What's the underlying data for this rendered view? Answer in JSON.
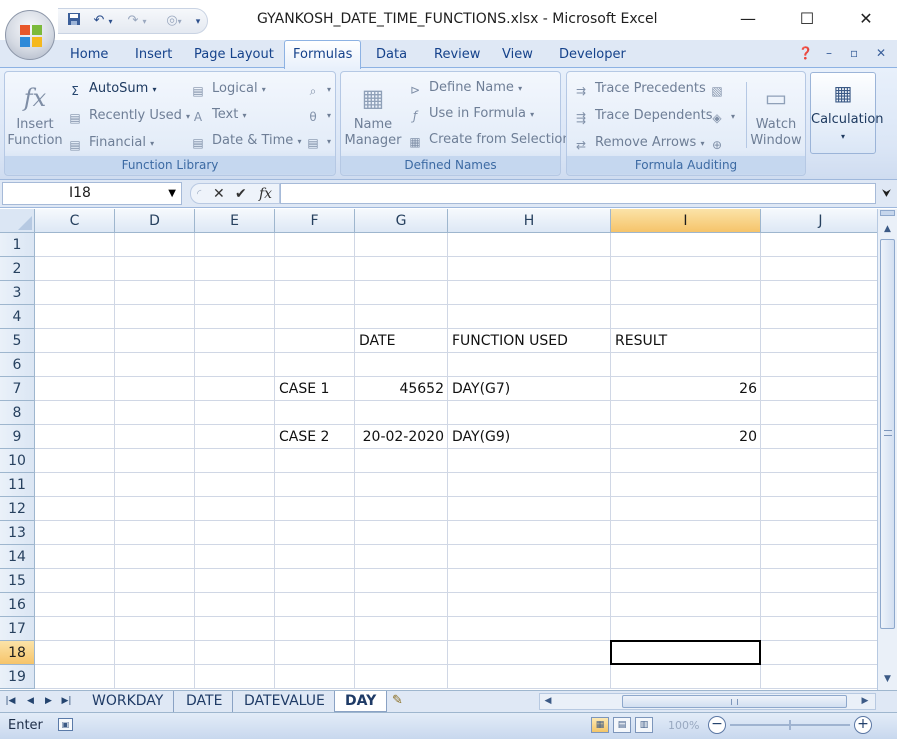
{
  "window": {
    "title": "GYANKOSH_DATE_TIME_FUNCTIONS.xlsx - Microsoft Excel",
    "minimize": "—",
    "maximize": "☐",
    "close": "✕"
  },
  "quick_access": {
    "save_icon": "save-icon",
    "undo_icon": "undo-icon",
    "redo_icon": "redo-icon"
  },
  "ribbon_tabs": [
    {
      "label": "Home"
    },
    {
      "label": "Insert"
    },
    {
      "label": "Page Layout"
    },
    {
      "label": "Formulas",
      "active": true
    },
    {
      "label": "Data"
    },
    {
      "label": "Review"
    },
    {
      "label": "View"
    },
    {
      "label": "Developer"
    }
  ],
  "ribbon": {
    "function_library": {
      "label": "Function Library",
      "insert_function": "Insert\nFunction",
      "insert_function_l1": "Insert",
      "insert_function_l2": "Function",
      "autosum": "AutoSum",
      "recently_used": "Recently Used",
      "financial": "Financial",
      "logical": "Logical",
      "text": "Text",
      "date_time": "Date & Time"
    },
    "defined_names": {
      "label": "Defined Names",
      "name_manager_l1": "Name",
      "name_manager_l2": "Manager",
      "define_name": "Define Name",
      "use_in_formula": "Use in Formula",
      "create_from_selection": "Create from Selection"
    },
    "formula_auditing": {
      "label": "Formula Auditing",
      "trace_precedents": "Trace Precedents",
      "trace_dependents": "Trace Dependents",
      "remove_arrows": "Remove Arrows",
      "watch_window_l1": "Watch",
      "watch_window_l2": "Window"
    },
    "calculation": {
      "label": "Calculation"
    }
  },
  "formula_bar": {
    "name_box": "I18",
    "formula": ""
  },
  "columns": [
    "C",
    "D",
    "E",
    "F",
    "G",
    "H",
    "I",
    "J"
  ],
  "selected_column": "I",
  "rows": [
    "1",
    "2",
    "3",
    "4",
    "5",
    "6",
    "7",
    "8",
    "9",
    "10",
    "11",
    "12",
    "13",
    "14",
    "15",
    "16",
    "17",
    "18",
    "19"
  ],
  "selected_row": "18",
  "cells": {
    "G5": "DATE",
    "H5": "FUNCTION USED",
    "I5": "RESULT",
    "F7": "CASE 1",
    "G7": "45652",
    "H7": "DAY(G7)",
    "I7": "26",
    "F9": "CASE 2",
    "G9": "20-02-2020",
    "H9": "DAY(G9)",
    "I9": "20"
  },
  "sheet_tabs": [
    {
      "label": "WORKDAY"
    },
    {
      "label": "DATE"
    },
    {
      "label": "DATEVALUE"
    },
    {
      "label": "DAY",
      "active": true
    }
  ],
  "status_bar": {
    "mode": "Enter",
    "zoom": "100%"
  }
}
